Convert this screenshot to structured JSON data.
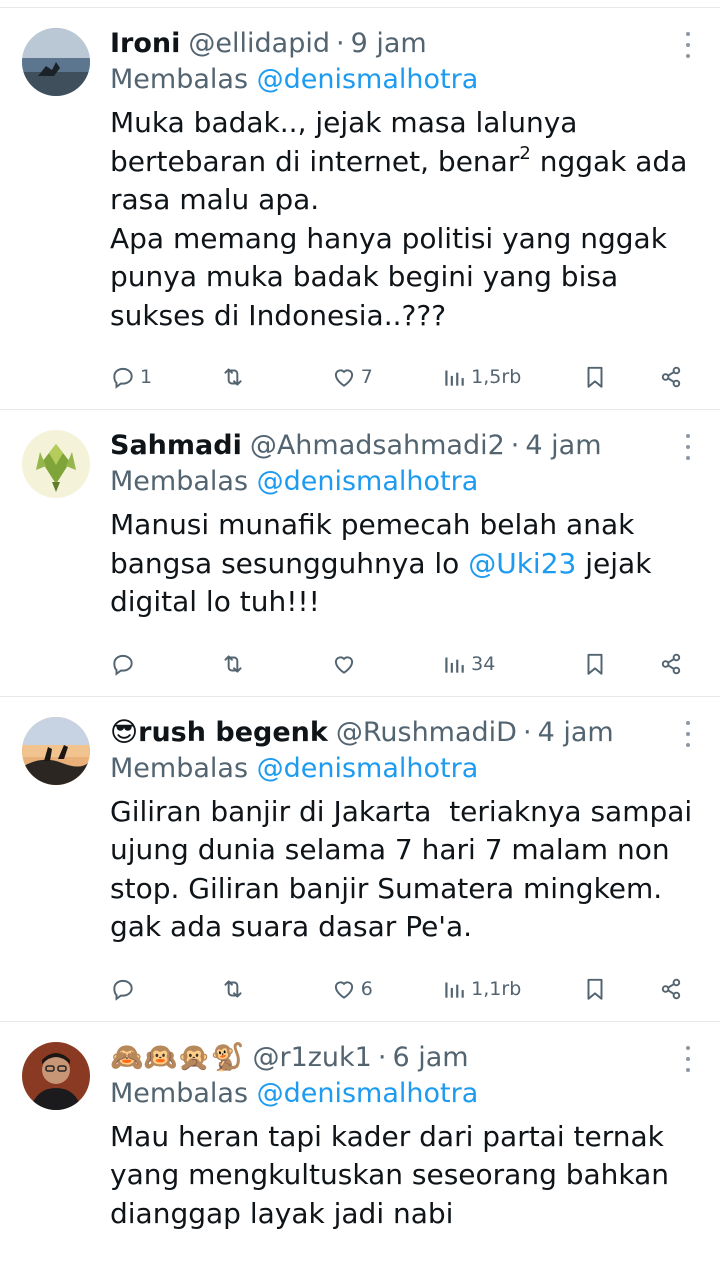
{
  "tweets": [
    {
      "name": "Ironi",
      "handle": "@ellidapid",
      "time": "9 jam",
      "reply_prefix": "Membalas",
      "reply_to": "@denismalhotra",
      "text_a": "Muka badak.., jejak masa lalunya\nbertebaran di internet, benar",
      "text_sup": "2",
      "text_b": " nggak ada\nrasa malu apa.\nApa memang hanya politisi yang nggak\npunya muka badak begini yang bisa\nsukses di Indonesia..???",
      "replies": "1",
      "retweets": "",
      "likes": "7",
      "views": "1,5rb"
    },
    {
      "name": "Sahmadi",
      "handle": "@Ahmadsahmadi2",
      "time": "4 jam",
      "reply_prefix": "Membalas",
      "reply_to": "@denismalhotra",
      "text_a": "Manusi munafik pemecah belah anak\nbangsa sesungguhnya lo ",
      "mention_inline": "@Uki23",
      "text_b": " jejak\ndigital lo tuh!!!",
      "replies": "",
      "retweets": "",
      "likes": "",
      "views": "34"
    },
    {
      "name": "😎rush begenk",
      "handle": "@RushmadiD",
      "time": "4 jam",
      "reply_prefix": "Membalas",
      "reply_to": "@denismalhotra",
      "text": "Giliran banjir di Jakarta  teriaknya sampai\nujung dunia selama 7 hari 7 malam non\nstop. Giliran banjir Sumatera mingkem.\ngak ada suara dasar Pe'a.",
      "replies": "",
      "retweets": "",
      "likes": "6",
      "views": "1,1rb"
    },
    {
      "name": "🙈🙉🙊🐒",
      "handle": "@r1zuk1",
      "time": "6 jam",
      "reply_prefix": "Membalas",
      "reply_to": "@denismalhotra",
      "text": "Mau heran tapi kader dari partai ternak\nyang mengkultuskan seseorang bahkan\ndianggap layak jadi nabi"
    }
  ],
  "icons": {
    "reply": "reply-icon",
    "retweet": "retweet-icon",
    "like": "heart-icon",
    "views": "views-icon",
    "bookmark": "bookmark-icon",
    "share": "share-icon",
    "more": "more-icon"
  },
  "colors": {
    "accent": "#1d9bf0",
    "secondary_text": "#536471",
    "divider": "#e6e9ea"
  }
}
